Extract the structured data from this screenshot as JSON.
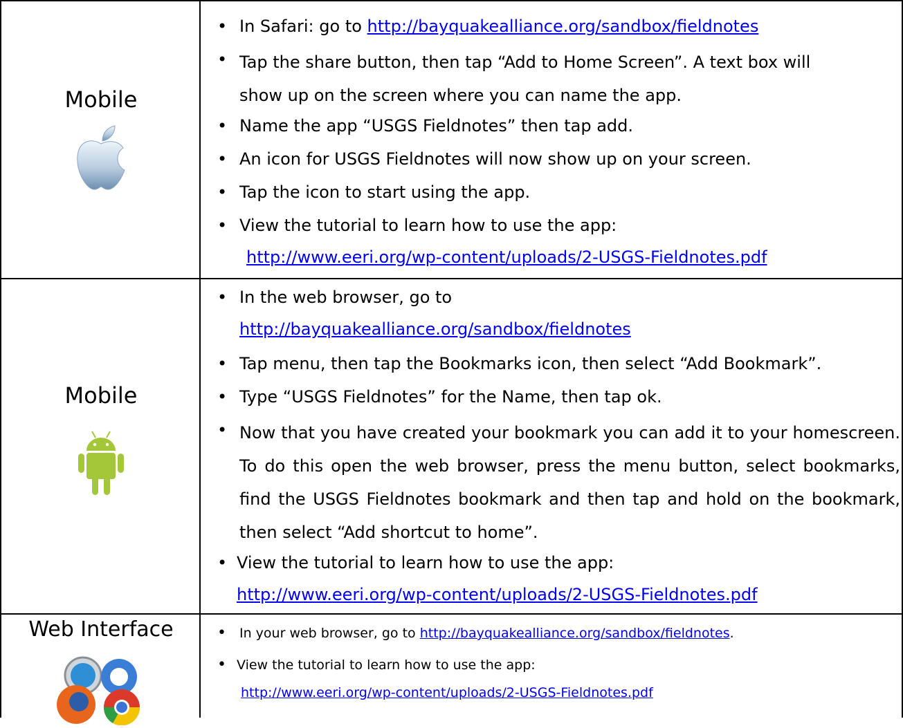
{
  "rows": [
    {
      "platform_label": "Mobile",
      "platform_icon": "apple-logo-icon",
      "steps": [
        {
          "text": "In Safari: go to ",
          "link": "http://bayquakealliance.org/sandbox/fieldnotes"
        },
        {
          "text": "Tap the share button, then tap “Add to Home Screen”. A text box will show up on the screen where you can name the app."
        },
        {
          "text": "Name the app “USGS Fieldnotes” then tap add."
        },
        {
          "text": "An icon for USGS Fieldnotes will now show up on your screen."
        },
        {
          "text": "Tap the icon to start using the app."
        },
        {
          "text": "View the tutorial to learn how to use the app:",
          "link": "http://www.eeri.org/wp-content/uploads/2-USGS-Fieldnotes.pdf"
        }
      ]
    },
    {
      "platform_label": "Mobile",
      "platform_icon": "android-robot-icon",
      "steps": [
        {
          "text": "In the web browser, go to",
          "link": "http://bayquakealliance.org/sandbox/fieldnotes"
        },
        {
          "text": "Tap menu, then tap the Bookmarks icon, then select “Add Bookmark”."
        },
        {
          "text": "Type “USGS Fieldnotes” for the Name, then tap ok."
        },
        {
          "text": "Now that you have created your bookmark you can add it to your homescreen. To do this open the web browser, press the menu button, select bookmarks, find the USGS Fieldnotes bookmark and then tap and hold on the bookmark, then select “Add shortcut to home”."
        },
        {
          "text": "View the tutorial to learn how to use the app:",
          "link": "http://www.eeri.org/wp-content/uploads/2-USGS-Fieldnotes.pdf"
        }
      ]
    },
    {
      "platform_label": "Web Interface",
      "platform_icon": "web-browsers-icon",
      "steps": [
        {
          "text": "In your web browser, go to ",
          "link": "http://bayquakealliance.org/sandbox/fieldnotes",
          "after": "."
        },
        {
          "text": "View the tutorial to learn how to use the app:",
          "link": "http://www.eeri.org/wp-content/uploads/2-USGS-Fieldnotes.pdf"
        }
      ]
    }
  ],
  "colors": {
    "link": "#0000ee",
    "android": "#a4c639",
    "apple_light": "#dfe9f3",
    "apple_dark": "#6f8fb0"
  }
}
